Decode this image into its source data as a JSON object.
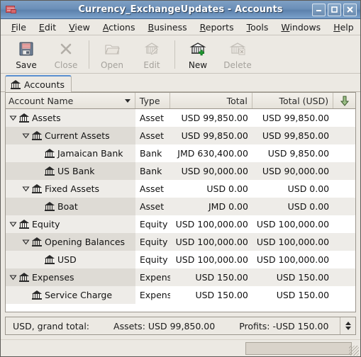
{
  "window": {
    "title": "Currency_ExchangeUpdates - Accounts",
    "icon": "accounts-file-icon",
    "buttons": {
      "minimize": "minimize-button",
      "maximize": "maximize-button",
      "close": "close-button"
    }
  },
  "menubar": [
    {
      "label": "File",
      "mnemonic": "F"
    },
    {
      "label": "Edit",
      "mnemonic": "E"
    },
    {
      "label": "View",
      "mnemonic": "V"
    },
    {
      "label": "Actions",
      "mnemonic": "A"
    },
    {
      "label": "Business",
      "mnemonic": "B"
    },
    {
      "label": "Reports",
      "mnemonic": "R"
    },
    {
      "label": "Tools",
      "mnemonic": "T"
    },
    {
      "label": "Windows",
      "mnemonic": "W"
    },
    {
      "label": "Help",
      "mnemonic": "H"
    }
  ],
  "toolbar": [
    {
      "label": "Save",
      "icon": "save-floppy-icon",
      "enabled": true
    },
    {
      "label": "Close",
      "icon": "close-x-icon",
      "enabled": false
    },
    {
      "label": "Open",
      "icon": "open-folder-icon",
      "enabled": false
    },
    {
      "label": "Edit",
      "icon": "edit-account-icon",
      "enabled": false
    },
    {
      "label": "New",
      "icon": "new-account-icon",
      "enabled": true
    },
    {
      "label": "Delete",
      "icon": "delete-account-icon",
      "enabled": false
    }
  ],
  "tabs": [
    {
      "label": "Accounts",
      "icon": "bank-icon",
      "active": true
    }
  ],
  "table": {
    "columns": [
      {
        "key": "name",
        "label": "Account Name",
        "sort_indicator": "chevron-down-icon"
      },
      {
        "key": "type",
        "label": "Type"
      },
      {
        "key": "total",
        "label": "Total"
      },
      {
        "key": "usd",
        "label": "Total (USD)"
      },
      {
        "key": "opts",
        "label": "",
        "icon": "column-options-arrow-icon"
      }
    ],
    "rows": [
      {
        "name": "Assets",
        "indent": 0,
        "twisty": "expanded",
        "type": "Asset",
        "total": "USD 99,850.00",
        "usd": "USD 99,850.00"
      },
      {
        "name": "Current Assets",
        "indent": 1,
        "twisty": "expanded",
        "type": "Asset",
        "total": "USD 99,850.00",
        "usd": "USD 99,850.00"
      },
      {
        "name": "Jamaican Bank",
        "indent": 2,
        "twisty": "none",
        "type": "Bank",
        "total": "JMD 630,400.00",
        "usd": "USD 9,850.00"
      },
      {
        "name": "US Bank",
        "indent": 2,
        "twisty": "none",
        "type": "Bank",
        "total": "USD 90,000.00",
        "usd": "USD 90,000.00"
      },
      {
        "name": "Fixed Assets",
        "indent": 1,
        "twisty": "expanded",
        "type": "Asset",
        "total": "USD 0.00",
        "usd": "USD 0.00"
      },
      {
        "name": "Boat",
        "indent": 2,
        "twisty": "none",
        "type": "Asset",
        "total": "JMD 0.00",
        "usd": "USD 0.00"
      },
      {
        "name": "Equity",
        "indent": 0,
        "twisty": "expanded",
        "type": "Equity",
        "total": "USD 100,000.00",
        "usd": "USD 100,000.00"
      },
      {
        "name": "Opening Balances",
        "indent": 1,
        "twisty": "expanded",
        "type": "Equity",
        "total": "USD 100,000.00",
        "usd": "USD 100,000.00"
      },
      {
        "name": "USD",
        "indent": 2,
        "twisty": "none",
        "type": "Equity",
        "total": "USD 100,000.00",
        "usd": "USD 100,000.00"
      },
      {
        "name": "Expenses",
        "indent": 0,
        "twisty": "expanded",
        "type": "Expens",
        "total": "USD 150.00",
        "usd": "USD 150.00"
      },
      {
        "name": "Service Charge",
        "indent": 1,
        "twisty": "none",
        "type": "Expens",
        "total": "USD 150.00",
        "usd": "USD 150.00"
      }
    ]
  },
  "summary": {
    "grand_total_label": "USD, grand total:",
    "assets": "Assets: USD 99,850.00",
    "profits": "Profits: -USD 150.00",
    "spinner": "summary-mode-spinner"
  },
  "colors": {
    "titlebar": "#6b8fb8",
    "window_bg": "#ece9e3",
    "row_alt": "#eeece8",
    "name_col_alt": "#dedbd5",
    "tab_accent": "#5a8fd0",
    "sort_arrow": "#6f8a5a"
  }
}
